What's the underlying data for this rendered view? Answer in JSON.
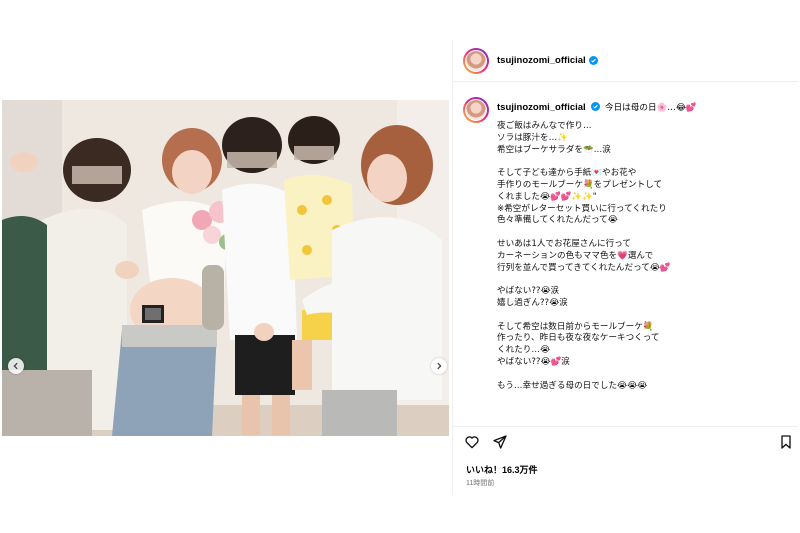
{
  "post": {
    "username": "tsujinozomi_official",
    "caption_head": "今日は母の日🌸…😂💕",
    "caption_lines": [
      "夜ご飯はみんなで作り…",
      "ソラは豚汁を…✨",
      "希空はブーケサラダを🥗…涙",
      "",
      "そして子ども達から手紙💌やお花や",
      "手作りのモールブーケ💐をプレゼントして",
      "くれました😭💕💕✨✨\"",
      "※希空がレターセット買いに行ってくれたり",
      "色々準備してくれたんだって😭",
      "",
      "せいあは1人でお花屋さんに行って",
      "カーネーションの色もママ色を💗選んで",
      "行列を並んで買ってきてくれたんだって😭💕",
      "",
      "やばない??😭涙",
      "嬉し過ぎん??😭涙",
      "",
      "そして希空は数日前からモールブーケ💐",
      "作ったり、昨日も夜な夜なケーキつくって",
      "くれたり…😭",
      "やばない??😭💕涙",
      "",
      "もう…幸せ過ぎる母の日でした😭😭😭"
    ],
    "likes": "いいね！16.3万件",
    "time": "11時間前"
  },
  "colors": {
    "verified": "#0095f6",
    "divider": "#efefef",
    "time": "#737373"
  },
  "icons": {
    "like": "heart-icon",
    "comment": "comment-icon",
    "share": "paper-plane-icon",
    "save": "bookmark-icon",
    "prev": "chevron-left-icon",
    "next": "chevron-right-icon"
  }
}
